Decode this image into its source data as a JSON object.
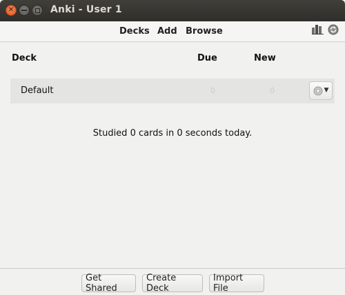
{
  "window": {
    "title": "Anki - User 1",
    "controls": {
      "close": "close-icon",
      "minimize": "minimize-icon",
      "maximize": "maximize-icon"
    }
  },
  "toolbar": {
    "decks": "Decks",
    "add": "Add",
    "browse": "Browse",
    "icons": [
      "stats-icon",
      "sync-icon"
    ]
  },
  "table": {
    "headers": {
      "deck": "Deck",
      "due": "Due",
      "new": "New"
    },
    "rows": [
      {
        "name": "Default",
        "due": "0",
        "new": "0",
        "options_icon": "gear-icon"
      }
    ]
  },
  "summary": "Studied 0 cards in 0 seconds today.",
  "bottom": {
    "get_shared": "Get Shared",
    "create_deck": "Create Deck",
    "import_file": "Import File"
  },
  "colors": {
    "titlebar": "#3c3b37",
    "close_button": "#e95420",
    "background": "#f1f1ef",
    "deck_row": "#e4e4e2"
  }
}
